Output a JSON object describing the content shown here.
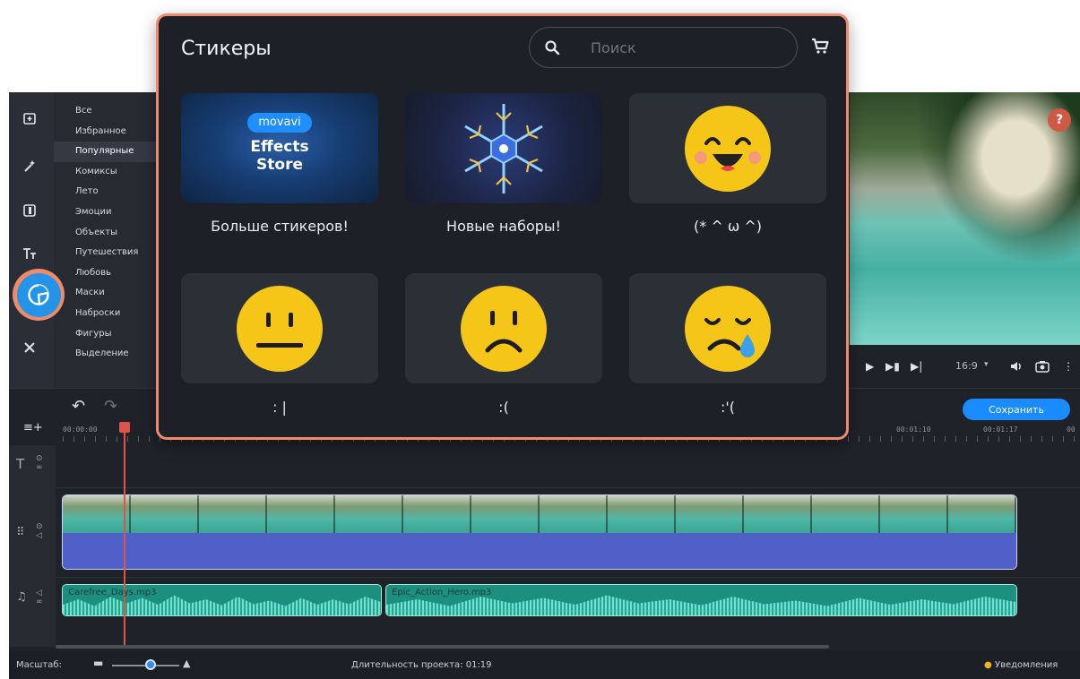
{
  "sticker_panel": {
    "title": "Стикеры",
    "search_placeholder": "Поиск",
    "tiles": [
      {
        "label": "Больше стикеров!",
        "badge": "movavi",
        "line1": "Effects",
        "line2": "Store"
      },
      {
        "label": "Новые наборы!"
      },
      {
        "label": "(* ^ ω ^)"
      },
      {
        "label": ": |"
      },
      {
        "label": ":("
      },
      {
        "label": ":'("
      }
    ]
  },
  "categories": [
    "Все",
    "Избранное",
    "Популярные",
    "Комиксы",
    "Лето",
    "Эмоции",
    "Объекты",
    "Путешествия",
    "Любовь",
    "Маски",
    "Наброски",
    "Фигуры",
    "Выделение"
  ],
  "active_category": "Популярные",
  "preview": {
    "help": "?"
  },
  "player": {
    "aspect": "16:9"
  },
  "timeline": {
    "save_label": "Сохранить",
    "ruler": [
      "00:00:00",
      "00:01:10",
      "00:01:17",
      "00"
    ],
    "audio_clips": [
      "Carefree_Days.mp3",
      "Epic_Action_Hero.mp3"
    ]
  },
  "status": {
    "zoom_label": "Масштаб:",
    "duration": "Длительность проекта: 01:19",
    "notifications": "Уведомления"
  },
  "colors": {
    "accent": "#1a8cff",
    "highlight": "#ef8a6c",
    "smiley": "#f5c518"
  }
}
